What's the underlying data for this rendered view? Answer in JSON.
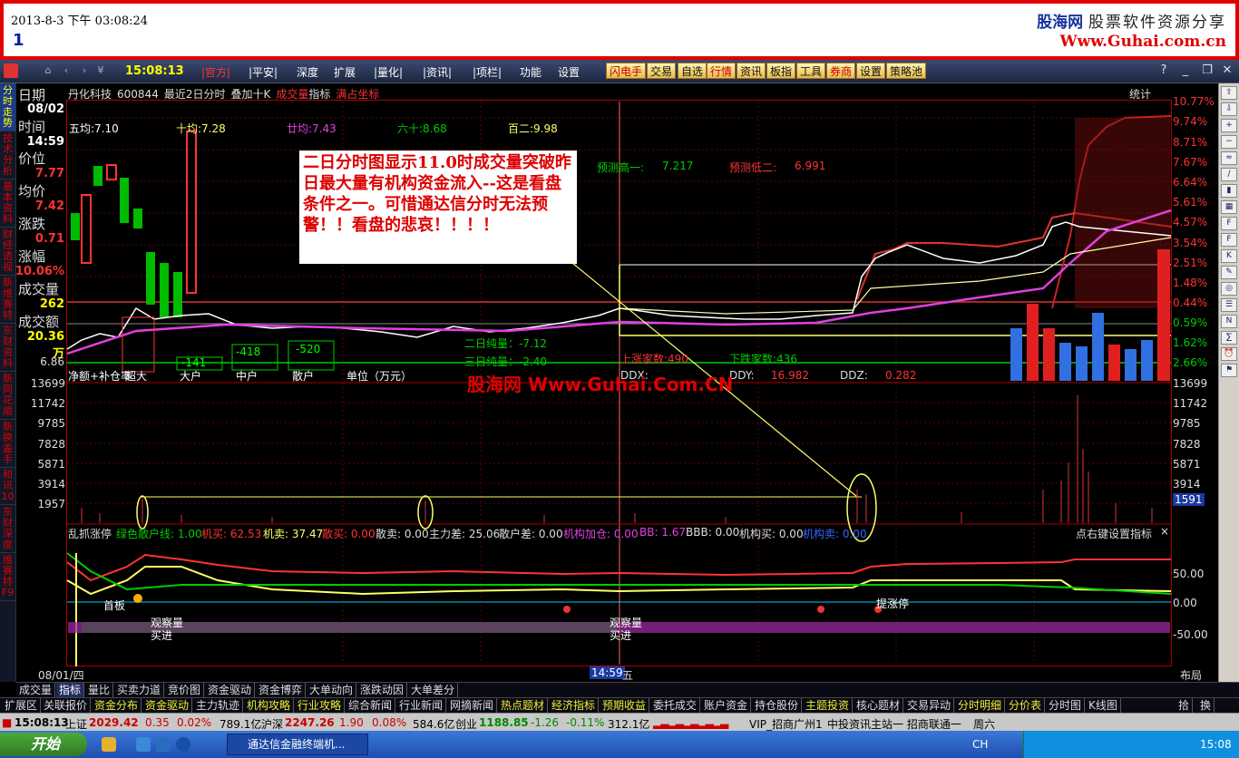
{
  "caption": {
    "datetime": "2013-8-3 下午 03:08:24",
    "number": "1",
    "brand_top_a": "股海网",
    "brand_top_b": "股票软件资源分享",
    "brand_url": "Www.Guhai.com.cn"
  },
  "menubar": {
    "clock": "15:08:13",
    "items": [
      "|官方|",
      "|平安|",
      "深度",
      "扩展",
      "|量化|",
      "|资讯|",
      "|项栏|",
      "功能",
      "设置"
    ],
    "tool_buttons": [
      "闪电手",
      "交易",
      "自选",
      "行情",
      "资讯",
      "板指",
      "工具",
      "券商",
      "设置",
      "策略池"
    ]
  },
  "leftnav": [
    "分时走势",
    "技术分析",
    "基本资料",
    "财经透视",
    "新维赛特",
    "东财资料",
    "新同花顺",
    "新换盖手",
    "和讯10",
    "东财深度",
    "维赛特F9"
  ],
  "info": {
    "date_label": "日期",
    "date": "08/02",
    "time_label": "时间",
    "time": "14:59",
    "price_label": "价位",
    "price": "7.77",
    "avg_label": "均价",
    "avg": "7.42",
    "chg_label": "涨跌",
    "chg": "0.71",
    "pct_label": "涨幅",
    "pct": "10.06%",
    "vol_label": "成交量",
    "vol": "262",
    "amt_label": "成交额",
    "amt": "20.36万",
    "low_val": "6.86"
  },
  "header": {
    "stock": "丹化科技",
    "code": "600844",
    "mode": "最近2日分时",
    "overlay": "叠加十K",
    "vol": "成交量",
    "index": "指标",
    "coord": "满占坐标",
    "tongji": "统计"
  },
  "ma": {
    "ma5": "五均:7.10",
    "ma10": "十均:7.28",
    "ma20": "廿均:7.43",
    "ma60": "六十:8.68",
    "ma100": "百二:9.98"
  },
  "forecast": {
    "hi": "预测高一:",
    "hi_v": "7.217",
    "lo": "预测低二:",
    "lo_v": "6.991"
  },
  "annotation": "二日分时图显示11.0时成交量突破昨日最大量有机构资金流入--这是看盘条件之一。可惜通达信分时无法预警！！看盘的悲哀！！！！",
  "pct_scale": [
    "10.77%",
    "9.74%",
    "8.71%",
    "7.67%",
    "6.64%",
    "5.61%",
    "4.57%",
    "3.54%",
    "2.51%",
    "1.48%",
    "0.44%",
    "0.59%",
    "1.62%",
    "2.66%"
  ],
  "vol_scale": [
    "13699",
    "11742",
    "9785",
    "7828",
    "5871",
    "3914",
    "1957"
  ],
  "vol_last": "1591",
  "net_flow": {
    "title": "净额+补仓率",
    "super": "超大",
    "big": "大户",
    "mid": "中户",
    "small": "散户",
    "unit": "单位（万元）",
    "big_v": "-141",
    "mid_v": "-418",
    "small_v": "-520"
  },
  "flow_text": {
    "d2": "二日纯量：-7.12",
    "d3": "三日纯量：-2.40",
    "up": "上涨家数:490",
    "down": "下跌家数:436",
    "ddx": "DDX:",
    "ddy": "DDY:",
    "ddy_v": "16.982",
    "ddz": "DDZ:",
    "ddz_v": "0.282"
  },
  "watermark": "股海网 Www.Guhai.Com.CN",
  "indicator": {
    "name": "乱抓涨停",
    "green_line": "绿色散户线: 1.00",
    "inst_buy": "机买: 62.53",
    "inst_sell": "机卖: 37.47",
    "retail_buy": "散买: 0.00",
    "retail_sell": "散卖: 0.00",
    "main_diff": "主力差: 25.06",
    "retail_diff": "散户差: 0.00",
    "inst_add": "机构加仓: 0.00",
    "bb": "BB: 1.67",
    "bbb": "BBB: 0.00",
    "inst_buy2": "机构买: 0.00",
    "inst_sell2": "机构卖: 0.00",
    "hint": "点右键设置指标",
    "scale": [
      "50.00",
      "0.00",
      "-50.00"
    ],
    "obs1": "观察量",
    "buy1": "买进",
    "obs2": "观察量",
    "buy2": "买进",
    "limit": "提涨停",
    "first": "首板"
  },
  "xaxis": {
    "left": "08/01/四",
    "cursor": "14:59",
    "cursor_day": "五",
    "layout": "布局"
  },
  "tabs1": [
    "成交量",
    "指标",
    "量比",
    "买卖力道",
    "竞价图",
    "资金驱动",
    "资金博弈",
    "大单动向",
    "涨跌动因",
    "大单差分"
  ],
  "tabs2": [
    "扩展区",
    "关联报价",
    "资金分布",
    "资金驱动",
    "主力轨迹",
    "机构攻略",
    "行业攻略",
    "综合新闻",
    "行业新闻",
    "网摘新闻",
    "热点题材",
    "经济指标",
    "预期收益",
    "委托成交",
    "账户资金",
    "持仓股份",
    "主题投资",
    "核心题材",
    "交易异动",
    "分时明细",
    "分价表",
    "分时图",
    "K线图",
    "拾",
    "换"
  ],
  "status": {
    "time": "15:08:13",
    "sh_label": "上证",
    "sh": "2029.42",
    "sh_chg": "0.35",
    "sh_pct": "0.02%",
    "sh_amt": "789.1亿",
    "hs_label": "沪深",
    "hs": "2247.26",
    "hs_chg": "1.90",
    "hs_pct": "0.08%",
    "hs_amt": "584.6亿",
    "cy_label": "创业",
    "cy": "1188.85",
    "cy_chg": "-1.26",
    "cy_pct": "-0.11%",
    "cy_amt": "312.1亿",
    "server": "VIP_招商广州1",
    "ticker": "中投资讯主站一 招商联通一",
    "day": "周六"
  },
  "taskbar": {
    "start": "开始",
    "app": "通达信金融终端机...",
    "lang": "CH",
    "clock": "15:08"
  }
}
